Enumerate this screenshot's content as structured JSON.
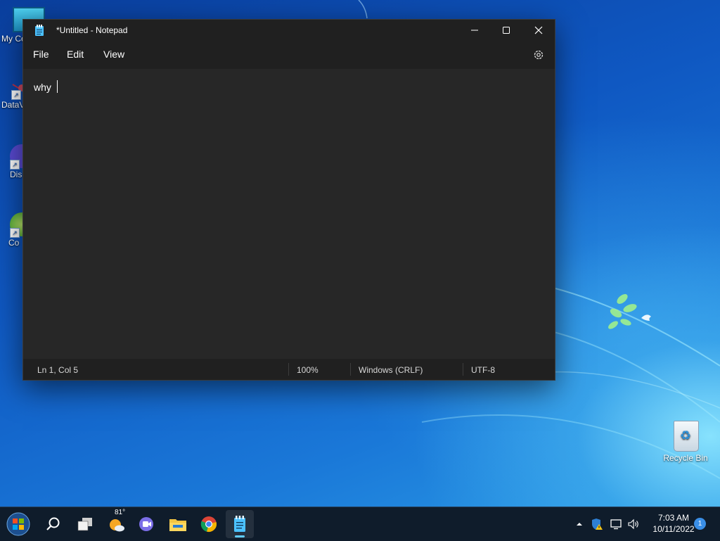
{
  "desktop": {
    "icons": [
      {
        "label": "My Co"
      },
      {
        "label": "DataV"
      },
      {
        "label": "Dis"
      },
      {
        "label": "Co"
      },
      {
        "label": "Recycle Bin"
      }
    ]
  },
  "window": {
    "title": "*Untitled - Notepad",
    "menu": {
      "file": "File",
      "edit": "Edit",
      "view": "View"
    },
    "editor_text": "why",
    "status": {
      "position": "Ln 1, Col 5",
      "zoom": "100%",
      "line_ending": "Windows (CRLF)",
      "encoding": "UTF-8"
    }
  },
  "taskbar": {
    "weather_temp": "81°",
    "time": "7:03 AM",
    "date": "10/11/2022",
    "notification_count": "1"
  },
  "icons": [
    "start-orb-icon",
    "search-icon",
    "task-view-icon",
    "weather-icon",
    "meet-icon",
    "file-explorer-icon",
    "chrome-icon",
    "notepad-icon",
    "settings-gear-icon",
    "minimize-icon",
    "maximize-icon",
    "close-icon",
    "recycle-bin-icon",
    "tray-chevron-icon",
    "security-icon",
    "network-icon",
    "volume-icon"
  ]
}
